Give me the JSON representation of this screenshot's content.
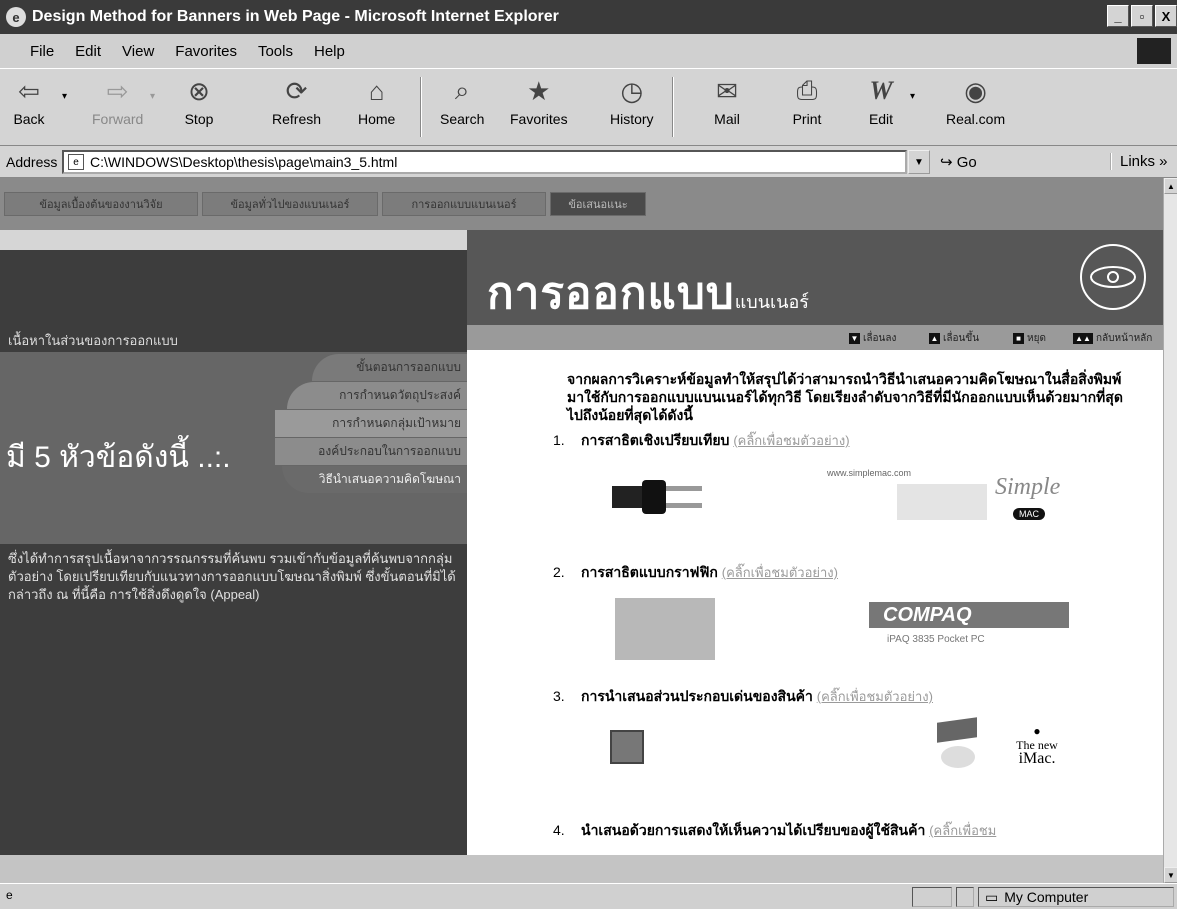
{
  "window": {
    "title": "Design Method for Banners in Web Page - Microsoft Internet Explorer",
    "controls": [
      "_",
      "▫",
      "X"
    ]
  },
  "menu": [
    "File",
    "Edit",
    "View",
    "Favorites",
    "Tools",
    "Help"
  ],
  "toolbar": {
    "back": "Back",
    "forward": "Forward",
    "stop": "Stop",
    "refresh": "Refresh",
    "home": "Home",
    "search": "Search",
    "favorites": "Favorites",
    "history": "History",
    "mail": "Mail",
    "print": "Print",
    "edit": "Edit",
    "realcom": "Real.com"
  },
  "address": {
    "label": "Address",
    "url": "C:\\WINDOWS\\Desktop\\thesis\\page\\main3_5.html",
    "go": "Go",
    "links": "Links »"
  },
  "site_nav": [
    "ข้อมูลเบื้องต้นของงานวิจัย",
    "ข้อมูลทั่วไปของแบนเนอร์",
    "การออกแบบแบนเนอร์",
    "ข้อเสนอแนะ"
  ],
  "left": {
    "heading": "เนื้อหาในส่วนของการออกแบบ",
    "big_title": "มี 5 หัวข้อดังนี้ ..:.",
    "tabs": [
      "ขั้นตอนการออกแบบ",
      "การกำหนดวัตถุประสงค์",
      "การกำหนดกลุ่มเป้าหมาย",
      "องค์ประกอบในการออกแบบ",
      "วิธีนำเสนอความคิดโฆษณา"
    ],
    "body": "ซึ่งได้ทำการสรุปเนื้อหาจากวรรณกรรมที่ค้นพบ รวมเข้ากับข้อมูลที่ค้นพบจากกลุ่มตัวอย่าง โดยเปรียบเทียบกับแนวทางการออกแบบโฆษณาสิ่งพิมพ์ ซึ่งขั้นตอนที่มิได้กล่าวถึง ณ ที่นี้คือ การใช้สิ่งดึงดูดใจ (Appeal)"
  },
  "header": {
    "title_big": "การออกแบบ",
    "title_small": "แบนเนอร์",
    "nav": [
      "เลื่อนลง",
      "เลื่อนขึ้น",
      "หยุด",
      "กลับหน้าหลัก"
    ]
  },
  "content": {
    "intro": "จากผลการวิเคราะห์ข้อมูลทำให้สรุปได้ว่าสามารถนำวิธีนำเสนอความคิดโฆษณาในสื่อสิ่งพิมพ์มาใช้กับการออกแบบแบนเนอร์ได้ทุกวิธี โดยเรียงลำดับจากวิธีที่มีนักออกแบบเห็นด้วยมากที่สุดไปถึงน้อยที่สุดได้ดังนี้",
    "items": [
      {
        "num": "1.",
        "text": "การสาธิตเชิงเปรียบเทียบ",
        "link": "(คลิ๊กเพื่อชมตัวอย่าง)"
      },
      {
        "num": "2.",
        "text": "การสาธิตแบบกราฟฟิก",
        "link": "(คลิ๊กเพื่อชมตัวอย่าง)"
      },
      {
        "num": "3.",
        "text": "การนำเสนอส่วนประกอบเด่นของสินค้า",
        "link": "(คลิ๊กเพื่อชมตัวอย่าง)"
      },
      {
        "num": "4.",
        "text": "นำเสนอด้วยการแสดงให้เห็นความได้เปรียบของผู้ใช้สินค้า",
        "link": "(คลิ๊กเพื่อชม"
      }
    ],
    "ex1_url": "www.simplemac.com",
    "ex1_logo": "Simple",
    "ex1_logo_tag": "MAC",
    "ex2_logo": "COMPAQ",
    "ex2_caption": "iPAQ 3835 Pocket PC",
    "ex3_text1": "The new",
    "ex3_text2": "iMac."
  },
  "status": {
    "zone": "My Computer"
  }
}
